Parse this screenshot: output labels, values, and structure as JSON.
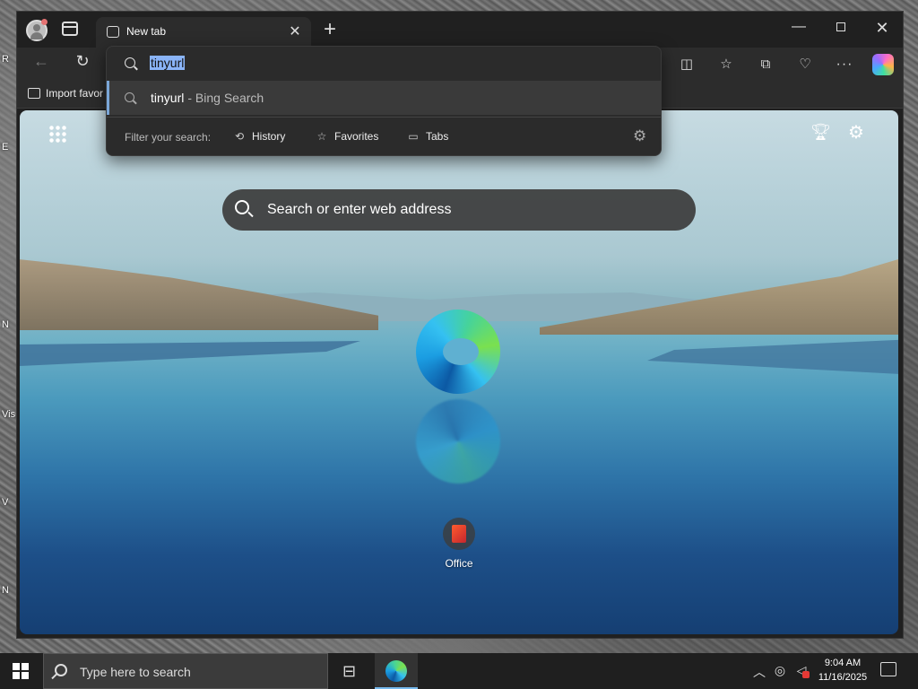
{
  "desktop": {
    "labels": [
      "R",
      "E",
      "N",
      "Vis",
      "V",
      "N"
    ]
  },
  "browser": {
    "tab": {
      "title": "New tab"
    },
    "new_tab_glyph": "+",
    "window_controls": {
      "minimize": "—",
      "close": "✕"
    },
    "toolbar": {
      "more_glyph": "···"
    },
    "favorites_bar": {
      "import_label": "Import favor"
    },
    "omnibox": {
      "value": "tinyurl",
      "suggestion": {
        "text": "tinyurl",
        "sub": "- Bing Search"
      },
      "filter_label": "Filter your search:",
      "filters": [
        "History",
        "Favorites",
        "Tabs"
      ]
    },
    "ntp": {
      "search_placeholder": "Search or enter web address",
      "tiles": [
        {
          "label": "Office"
        }
      ]
    }
  },
  "taskbar": {
    "search_placeholder": "Type here to search",
    "clock": {
      "time": "9:04 AM",
      "date": "11/16/2025"
    }
  },
  "colors": {
    "accent": "#76b9ed",
    "selection": "#8ab4f8",
    "chrome_bg": "#2c2c2c"
  }
}
